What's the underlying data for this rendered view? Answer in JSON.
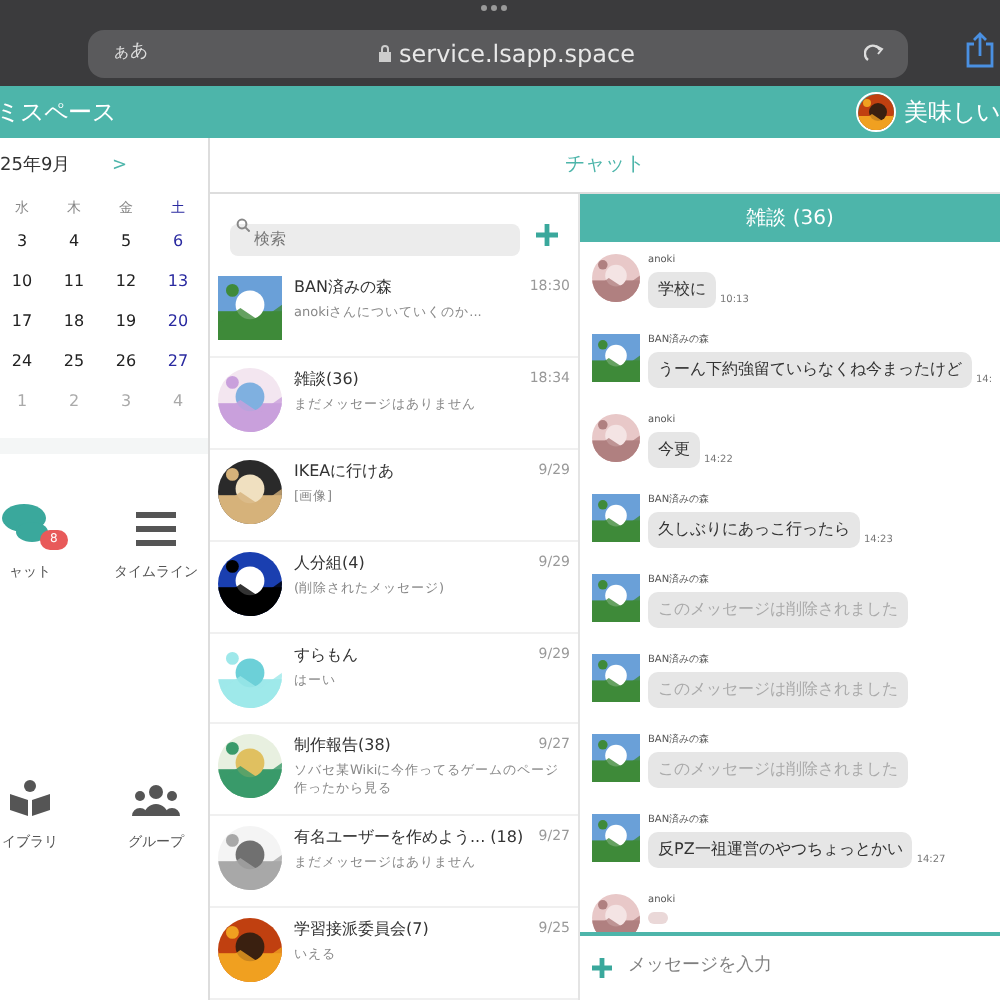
{
  "browser": {
    "text_size": "ぁあ",
    "url": "service.lsapp.space"
  },
  "header": {
    "title": "ミスペース",
    "user": "美味しい"
  },
  "calendar": {
    "month": "25年9月",
    "next": ">",
    "weekdays": [
      {
        "label": "水",
        "weekend": false
      },
      {
        "label": "木",
        "weekend": false
      },
      {
        "label": "金",
        "weekend": false
      },
      {
        "label": "土",
        "weekend": true
      }
    ],
    "weeks": [
      [
        {
          "day": "3",
          "other_month": false
        },
        {
          "day": "4",
          "other_month": false
        },
        {
          "day": "5",
          "other_month": false
        },
        {
          "day": "6",
          "other_month": false
        }
      ],
      [
        {
          "day": "10",
          "other_month": false
        },
        {
          "day": "11",
          "other_month": false
        },
        {
          "day": "12",
          "other_month": false
        },
        {
          "day": "13",
          "other_month": false
        }
      ],
      [
        {
          "day": "17",
          "other_month": false
        },
        {
          "day": "18",
          "other_month": false
        },
        {
          "day": "19",
          "other_month": false
        },
        {
          "day": "20",
          "other_month": false
        }
      ],
      [
        {
          "day": "24",
          "other_month": false
        },
        {
          "day": "25",
          "other_month": false
        },
        {
          "day": "26",
          "other_month": false
        },
        {
          "day": "27",
          "other_month": false
        }
      ],
      [
        {
          "day": "1",
          "other_month": true
        },
        {
          "day": "2",
          "other_month": true
        },
        {
          "day": "3",
          "other_month": true
        },
        {
          "day": "4",
          "other_month": true
        }
      ]
    ]
  },
  "apps": [
    {
      "kind": "chat",
      "label": "ャット",
      "badge": "8"
    },
    {
      "kind": "timeline",
      "label": "タイムライン"
    },
    {
      "kind": "library",
      "label": "イブラリ"
    },
    {
      "kind": "group",
      "label": "グループ"
    }
  ],
  "chat_title": "チャット",
  "search": {
    "placeholder": "検索"
  },
  "rooms": [
    {
      "name": "BAN済みの森",
      "time": "18:30",
      "preview": "anokiさんについていくのか..."
    },
    {
      "name": "雑談(36)",
      "time": "18:34",
      "preview": "まだメッセージはありません"
    },
    {
      "name": "IKEAに行けあ",
      "time": "9/29",
      "preview": "[画像]"
    },
    {
      "name": "人分組(4)",
      "time": "9/29",
      "preview": "(削除されたメッセージ)"
    },
    {
      "name": "すらもん",
      "time": "9/29",
      "preview": "はーい"
    },
    {
      "name": "制作報告(38)",
      "time": "9/27",
      "preview": "ソバセ某Wikiに今作ってるゲームのページ作ったから見る"
    },
    {
      "name": "有名ユーザーを作めよう... (18)",
      "time": "9/27",
      "preview": "まだメッセージはありません"
    },
    {
      "name": "学習接派委員会(7)",
      "time": "9/25",
      "preview": "いえる"
    }
  ],
  "room_title": "雑談 (36)",
  "messages": [
    {
      "sender": "anoki",
      "kind": "text",
      "text": "学校に",
      "time": "10:13"
    },
    {
      "sender": "BAN済みの森",
      "kind": "text",
      "text": "うーん下約強留ていらなくね今まったけど",
      "time": "14:"
    },
    {
      "sender": "anoki",
      "kind": "text",
      "text": "今更",
      "time": "14:22"
    },
    {
      "sender": "BAN済みの森",
      "kind": "text",
      "text": "久しぶりにあっこ行ったら",
      "time": "14:23"
    },
    {
      "sender": "BAN済みの森",
      "kind": "deleted",
      "text": "このメッセージは削除されました"
    },
    {
      "sender": "BAN済みの森",
      "kind": "deleted",
      "text": "このメッセージは削除されました"
    },
    {
      "sender": "BAN済みの森",
      "kind": "deleted",
      "text": "このメッセージは削除されました"
    },
    {
      "sender": "BAN済みの森",
      "kind": "text",
      "text": "反PZ一祖運営のやつちょっとかい",
      "time": "14:27"
    },
    {
      "sender": "anoki",
      "kind": "partial"
    }
  ],
  "composer": {
    "placeholder": "メッセージを入力"
  }
}
